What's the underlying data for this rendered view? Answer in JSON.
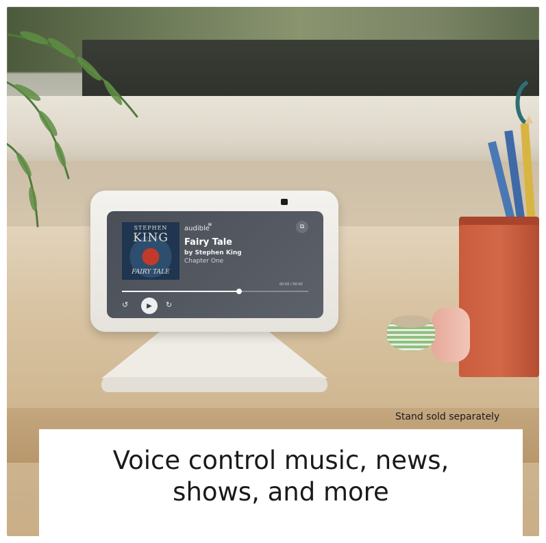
{
  "screen": {
    "app_brand": "audible",
    "title": "Fairy Tale",
    "byline": "by Stephen King",
    "chapter": "Chapter One",
    "time": "00:00 / 00:00",
    "progress": 0.63,
    "cover": {
      "author": "STEPHEN",
      "name": "KING",
      "title": "FAIRY TALE"
    },
    "icons": {
      "cast": "cast-icon",
      "rewind": "rewind-icon",
      "play": "play-icon",
      "forward": "forward-icon"
    }
  },
  "stand_note": "Stand sold separately",
  "caption": {
    "line1": "Voice control music, news,",
    "line2": "shows, and more"
  }
}
